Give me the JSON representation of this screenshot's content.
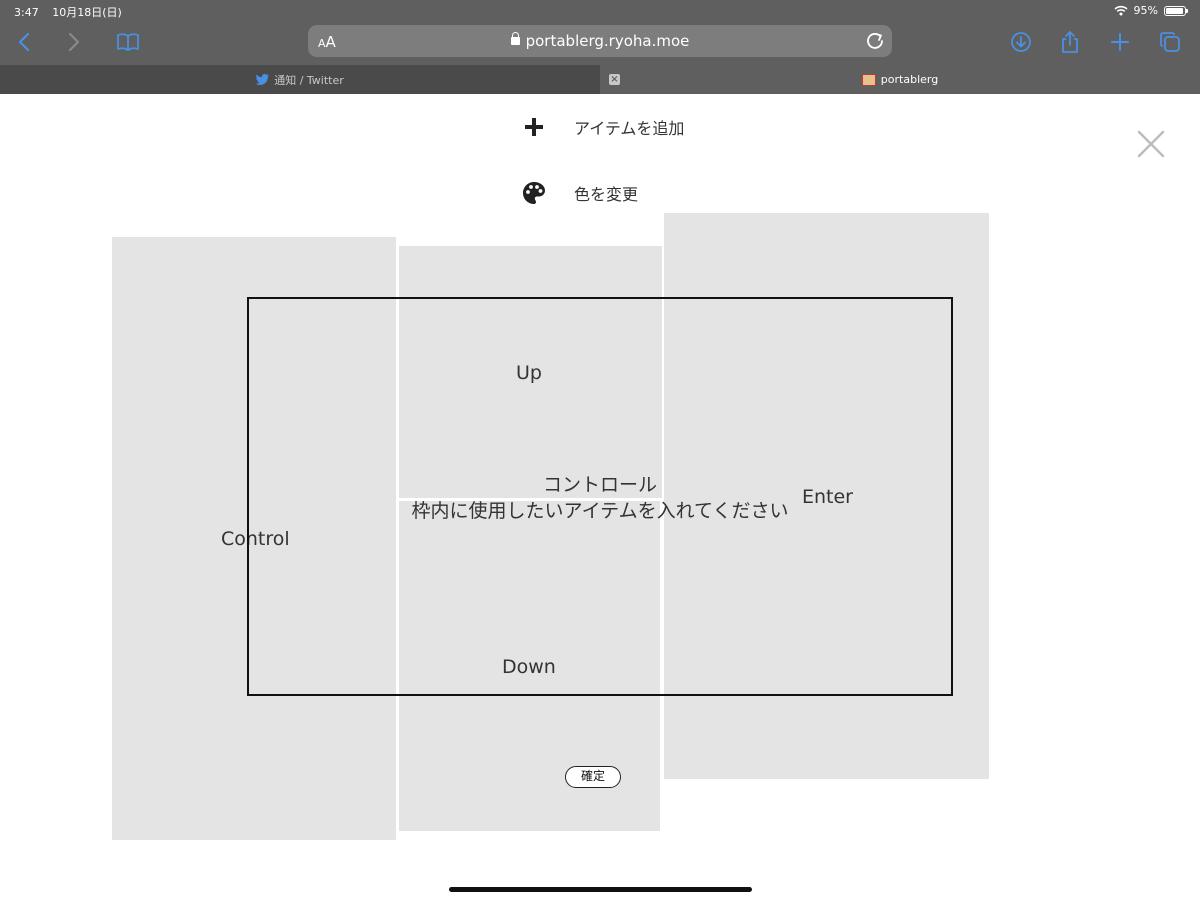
{
  "status_bar": {
    "time": "3:47",
    "date": "10月18日(日)",
    "battery": "95%",
    "battery_level": 0.95
  },
  "toolbar": {
    "text_size_label": "AA",
    "url": "portablerg.ryoha.moe"
  },
  "tabs": [
    {
      "label": "通知 / Twitter",
      "active": false
    },
    {
      "label": "portablerg",
      "active": true
    }
  ],
  "menu": {
    "add_item_label": "アイテムを追加",
    "change_color_label": "色を変更"
  },
  "keys": {
    "control": "Control",
    "up": "Up",
    "down": "Down",
    "enter": "Enter"
  },
  "frame": {
    "title": "コントロール",
    "instruction": "枠内に使用したいアイテムを入れてください"
  },
  "confirm_label": "確定",
  "colors": {
    "browser_chrome": "#5f5f5f",
    "inactive_tab": "#4a4a4a",
    "accent_blue": "#4a90e2",
    "panel_gray": "#e4e4e4"
  }
}
